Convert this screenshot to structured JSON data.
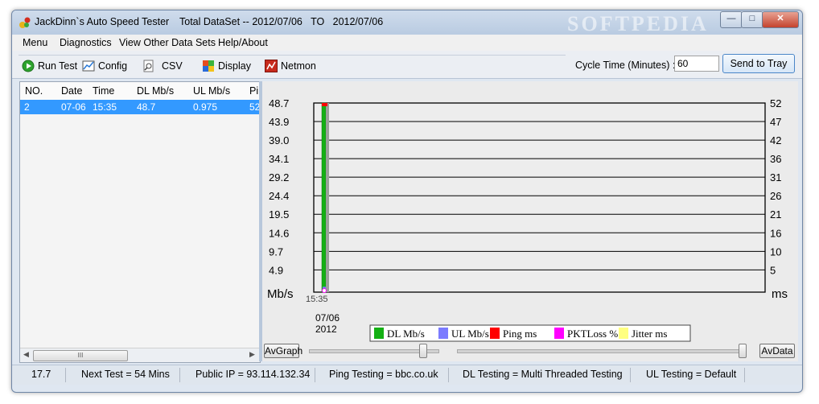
{
  "window": {
    "title": "JackDinn`s Auto Speed Tester",
    "dataset_range": "Total DataSet -- 2012/07/06   TO   2012/07/06",
    "watermark": "SOFTPEDIA"
  },
  "menu": [
    "Menu",
    "Diagnostics",
    "View Other Data Sets",
    "Help/About"
  ],
  "toolbar": {
    "run_test": "Run Test",
    "config": "Config",
    "csv": "CSV",
    "display": "Display",
    "netmon": "Netmon",
    "cycle_label": "Cycle Time (Minutes) :",
    "cycle_value": "60",
    "send_to_tray": "Send to Tray"
  },
  "table": {
    "columns": [
      "NO.",
      "Date",
      "Time",
      "DL Mb/s",
      "UL Mb/s",
      "Pi"
    ],
    "rows": [
      {
        "no": "2",
        "date": "07-06",
        "time": "15:35",
        "dl": "48.7",
        "ul": "0.975",
        "ping": "52"
      }
    ],
    "scroll_thumb": "III"
  },
  "chart_data": {
    "type": "bar",
    "categories": [
      "15:35"
    ],
    "series": [
      {
        "name": "DL Mb/s",
        "values": [
          48.7
        ],
        "color": "#14b014"
      },
      {
        "name": "UL Mb/s",
        "values": [
          0.975
        ],
        "color": "#7b7bff"
      },
      {
        "name": "Ping ms",
        "values": [
          52
        ],
        "color": "#ff0000"
      },
      {
        "name": "PKTLoss %",
        "values": [
          0
        ],
        "color": "#ff00ff"
      },
      {
        "name": "Jitter ms",
        "values": [
          0
        ],
        "color": "#ffff80"
      }
    ],
    "y_left_ticks": [
      "48.7",
      "43.9",
      "39.0",
      "34.1",
      "29.2",
      "24.4",
      "19.5",
      "14.6",
      "9.7",
      "4.9"
    ],
    "y_right_ticks": [
      "52",
      "47",
      "42",
      "36",
      "31",
      "26",
      "21",
      "16",
      "10",
      "5"
    ],
    "y_left_label": "Mb/s",
    "y_right_label": "ms",
    "x_label": "15:35",
    "date_label_1": "07/06",
    "date_label_2": "2012",
    "ylim_left": [
      0,
      48.7
    ],
    "ylim_right": [
      0,
      52
    ],
    "grid": true,
    "legend_position": "bottom"
  },
  "controls": {
    "avgraph": "AvGraph",
    "avdata": "AvData",
    "slider1_level": 0.88,
    "slider2_level": 0.99
  },
  "status": {
    "version": "17.7",
    "next_test": "Next Test = 54 Mins",
    "public_ip": "Public IP = 93.114.132.34",
    "ping_testing": "Ping Testing = bbc.co.uk",
    "dl_testing": "DL Testing = Multi Threaded Testing",
    "ul_testing": "UL Testing = Default"
  },
  "colors": {
    "selection": "#3399ff",
    "dl_bar": "#14b014",
    "ping_marker": "#ff0000"
  }
}
